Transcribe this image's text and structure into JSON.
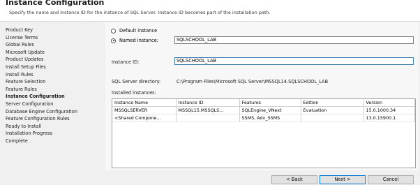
{
  "header": {
    "title": "Instance Configuration",
    "subtitle": "Specify the name and instance ID for the instance of SQL Server. Instance ID becomes part of the installation path."
  },
  "sidebar": {
    "items": [
      {
        "label": "Product Key"
      },
      {
        "label": "License Terms"
      },
      {
        "label": "Global Rules"
      },
      {
        "label": "Microsoft Update"
      },
      {
        "label": "Product Updates"
      },
      {
        "label": "Install Setup Files"
      },
      {
        "label": "Install Rules"
      },
      {
        "label": "Feature Selection"
      },
      {
        "label": "Feature Rules"
      },
      {
        "label": "Instance Configuration"
      },
      {
        "label": "Server Configuration"
      },
      {
        "label": "Database Engine Configuration"
      },
      {
        "label": "Feature Configuration Rules"
      },
      {
        "label": "Ready to Install"
      },
      {
        "label": "Installation Progress"
      },
      {
        "label": "Complete"
      }
    ],
    "active_index": 9
  },
  "instance": {
    "default_label": "Default instance",
    "named_label": "Named instance:",
    "named_value": "SQLSCHOOL_LAB",
    "id_label": "Instance ID:",
    "id_value": "SQLSCHOOL_LAB",
    "dir_label": "SQL Server directory:",
    "dir_value": "C:\\Program Files\\Microsoft SQL Server\\MSSQL14.SQLSCHOOL_LAB",
    "installed_label": "Installed instances:"
  },
  "installed_table": {
    "columns": [
      "Instance Name",
      "Instance ID",
      "Features",
      "Edition",
      "Version"
    ],
    "rows": [
      [
        "MSSQLSERVER",
        "MSSQL15.MSSQLS...",
        "SQLEngine_VNext",
        "Evaluation",
        "15.0.1000.34"
      ],
      [
        "<Shared Compone...",
        "",
        "SSMS, Adv_SSMS",
        "",
        "13.0.15900.1"
      ]
    ]
  },
  "footer": {
    "back_label": "< Back",
    "next_label": "Next >",
    "cancel_label": "Cancel"
  }
}
